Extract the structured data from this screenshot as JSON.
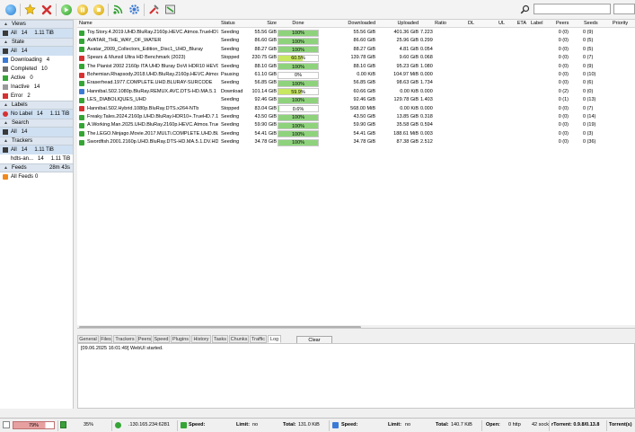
{
  "toolbar": {
    "icons": [
      "add-torrent-icon",
      "add-url-icon",
      "remove-icon",
      "start-icon",
      "pause-icon",
      "stop-icon",
      "rss-icon",
      "settings-icon",
      "tools-icon",
      "about-icon",
      "search-icon"
    ],
    "search_value": "",
    "search_engine": ""
  },
  "sidebar": {
    "views": {
      "title": "Views",
      "all_label": "All",
      "all_count": "14",
      "all_size": "1.11 TiB"
    },
    "state": {
      "title": "State",
      "items": [
        {
          "label": "All",
          "count": "14",
          "color": "#3a3a3a"
        },
        {
          "label": "Downloading",
          "count": "4",
          "color": "#3b7bd6"
        },
        {
          "label": "Completed",
          "count": "10",
          "color": "#6f6f6f"
        },
        {
          "label": "Active",
          "count": "0",
          "color": "#35a535"
        },
        {
          "label": "Inactive",
          "count": "14",
          "color": "#9a9a9a"
        },
        {
          "label": "Error",
          "count": "2",
          "color": "#d63232"
        }
      ]
    },
    "labels": {
      "title": "Labels",
      "no_label": "No Label",
      "count": "14",
      "size": "1.11 TiB"
    },
    "search": {
      "title": "Search",
      "all_label": "All",
      "all_count": "14"
    },
    "trackers": {
      "title": "Trackers",
      "all_label": "All",
      "all_count": "14",
      "all_size": "1.11 TiB",
      "tracker_label": "hdts-an...",
      "tracker_count": "14",
      "tracker_size": "1.11 TiB"
    },
    "feeds": {
      "title": "Feeds",
      "time": "28m 43s",
      "all_label": "All Feeds",
      "all_count": "0"
    }
  },
  "list": {
    "columns": [
      "Name",
      "Status",
      "Size",
      "Done",
      "Downloaded",
      "Uploaded",
      "Ratio",
      "DL",
      "UL",
      "ETA",
      "Label",
      "Peers",
      "Seeds",
      "Priority"
    ],
    "rows": [
      {
        "name": "Toy.Story.4.2019.UHD.BluRay.2160p.HEVC.Atmos.TrueHD7.1...",
        "status": "Seeding",
        "size": "55.56 GiB",
        "done": 1.0,
        "done_text": "100%",
        "downloaded": "55.56 GiB",
        "uploaded": "401.36 GiB",
        "ratio": "7.223",
        "peers": "0 (0)",
        "seeds": "0 (9)",
        "icon": "#35a535"
      },
      {
        "name": "AVATAR_THE_WAY_OF_WATER",
        "status": "Seeding",
        "size": "86.60 GiB",
        "done": 1.0,
        "done_text": "100%",
        "downloaded": "86.60 GiB",
        "uploaded": "25.96 GiB",
        "ratio": "0.299",
        "peers": "0 (0)",
        "seeds": "0 (5)",
        "icon": "#35a535"
      },
      {
        "name": "Avatar_2009_Collectors_Edition_Disc1_UHD_Bluray",
        "status": "Seeding",
        "size": "88.27 GiB",
        "done": 1.0,
        "done_text": "100%",
        "downloaded": "88.27 GiB",
        "uploaded": "4.81 GiB",
        "ratio": "0.054",
        "peers": "0 (0)",
        "seeds": "0 (5)",
        "icon": "#35a535"
      },
      {
        "name": "Spears & Munsil Ultra HD Benchmark (2023)",
        "status": "Stopped",
        "size": "230.75 GiB",
        "done": 0.605,
        "done_text": "60.5%",
        "downloaded": "139.78 GiB",
        "uploaded": "9.60 GiB",
        "ratio": "0.068",
        "peers": "0 (0)",
        "seeds": "0 (7)",
        "icon": "#d63232"
      },
      {
        "name": "The Pianist 2002 2160p ITA UHD Bluray DoVi HDR10 HEVC ...",
        "status": "Seeding",
        "size": "88.10 GiB",
        "done": 1.0,
        "done_text": "100%",
        "downloaded": "88.10 GiB",
        "uploaded": "95.23 GiB",
        "ratio": "1.080",
        "peers": "0 (0)",
        "seeds": "0 (9)",
        "icon": "#35a535"
      },
      {
        "name": "Bohemian.Rhapsody.2018.UHD.BluRay.2160p.HEVC.Atmos.T...",
        "status": "Pausing",
        "size": "61.10 GiB",
        "done": 0.0,
        "done_text": "0%",
        "downloaded": "0.00 KiB",
        "uploaded": "104.97 MiB",
        "ratio": "0.000",
        "peers": "0 (0)",
        "seeds": "0 (10)",
        "icon": "#d63232"
      },
      {
        "name": "Eraserhead.1977.COMPLETE.UHD.BLURAY-SURCODE",
        "status": "Seeding",
        "size": "56.85 GiB",
        "done": 1.0,
        "done_text": "100%",
        "downloaded": "56.85 GiB",
        "uploaded": "98.63 GiB",
        "ratio": "1.734",
        "peers": "0 (0)",
        "seeds": "0 (6)",
        "icon": "#35a535"
      },
      {
        "name": "Hannibal.S02.1080p.BluRay.REMUX.AVC.DTS-HD.MA.5.1",
        "status": "Download",
        "size": "101.14 GiB",
        "done": 0.599,
        "done_text": "59.9%",
        "downloaded": "60.66 GiB",
        "uploaded": "0.00 KiB",
        "ratio": "0.000",
        "peers": "0 (2)",
        "seeds": "0 (0)",
        "icon": "#3b7bd6"
      },
      {
        "name": "LES_DIABOLIQUES_UHD",
        "status": "Seeding",
        "size": "92.46 GiB",
        "done": 1.0,
        "done_text": "100%",
        "downloaded": "92.46 GiB",
        "uploaded": "129.78 GiB",
        "ratio": "1.403",
        "peers": "0 (1)",
        "seeds": "0 (13)",
        "icon": "#35a535"
      },
      {
        "name": "Hannibal.S02.Hybrid.1080p.BluRay.DTS.x264-NTb",
        "status": "Stopped",
        "size": "83.04 GiB",
        "done": 0.006,
        "done_text": "0.6%",
        "downloaded": "568.00 MiB",
        "uploaded": "0.00 KiB",
        "ratio": "0.000",
        "peers": "0 (0)",
        "seeds": "0 (7)",
        "icon": "#d63232"
      },
      {
        "name": "Freaky.Tales.2024.2160p.UHD.BluRay.HDR10+.TrueHD.7.1.x2...",
        "status": "Seeding",
        "size": "43.50 GiB",
        "done": 1.0,
        "done_text": "100%",
        "downloaded": "43.50 GiB",
        "uploaded": "13.85 GiB",
        "ratio": "0.318",
        "peers": "0 (0)",
        "seeds": "0 (14)",
        "icon": "#35a535"
      },
      {
        "name": "A.Working.Man.2025.UHD.BluRay.2160p.HEVC.Atmos.TrueHD...",
        "status": "Seeding",
        "size": "59.90 GiB",
        "done": 1.0,
        "done_text": "100%",
        "downloaded": "59.90 GiB",
        "uploaded": "35.58 GiB",
        "ratio": "0.594",
        "peers": "0 (0)",
        "seeds": "0 (19)",
        "icon": "#35a535"
      },
      {
        "name": "The.LEGO.Ninjago.Movie.2017.MULTi.COMPLETE.UHD.BLURAY...",
        "status": "Seeding",
        "size": "54.41 GiB",
        "done": 1.0,
        "done_text": "100%",
        "downloaded": "54.41 GiB",
        "uploaded": "188.61 MiB",
        "ratio": "0.003",
        "peers": "0 (0)",
        "seeds": "0 (3)",
        "icon": "#35a535"
      },
      {
        "name": "Swordfish.2001.2160p.UHD.BluRay.DTS-HD.MA.5.1.DV.HDR...",
        "status": "Seeding",
        "size": "34.78 GiB",
        "done": 1.0,
        "done_text": "100%",
        "downloaded": "34.78 GiB",
        "uploaded": "87.38 GiB",
        "ratio": "2.512",
        "peers": "0 (0)",
        "seeds": "0 (36)",
        "icon": "#35a535"
      }
    ]
  },
  "detail": {
    "tabs": [
      "General",
      "Files",
      "Trackers",
      "Peers",
      "Speed",
      "Plugins",
      "History",
      "Tasks",
      "Chunks",
      "Traffic",
      "Log"
    ],
    "active_tab": "Log",
    "clear_label": "Clear",
    "log_lines": [
      "[09.06.2025 16:01:49] WebUI started."
    ]
  },
  "statusbar": {
    "disk_percent": "79%",
    "disk_fraction": 0.79,
    "cpu_percent": "35%",
    "ip": ".130.165.234:6281",
    "down_label": "Speed:",
    "down_limit_label": "Limit:",
    "down_limit": "no",
    "down_total_label": "Total:",
    "down_total": "131.0 KiB",
    "up_label": "Speed:",
    "up_limit_label": "Limit:",
    "up_limit": "no",
    "up_total_label": "Total:",
    "up_total": "140.7 KiB",
    "open_label": "Open:",
    "open_http": "0 http",
    "open_sock": "42 sock",
    "version": "rTorrent: 0.9.8/0.13.8",
    "torrent_label": "Torrent(s)"
  }
}
